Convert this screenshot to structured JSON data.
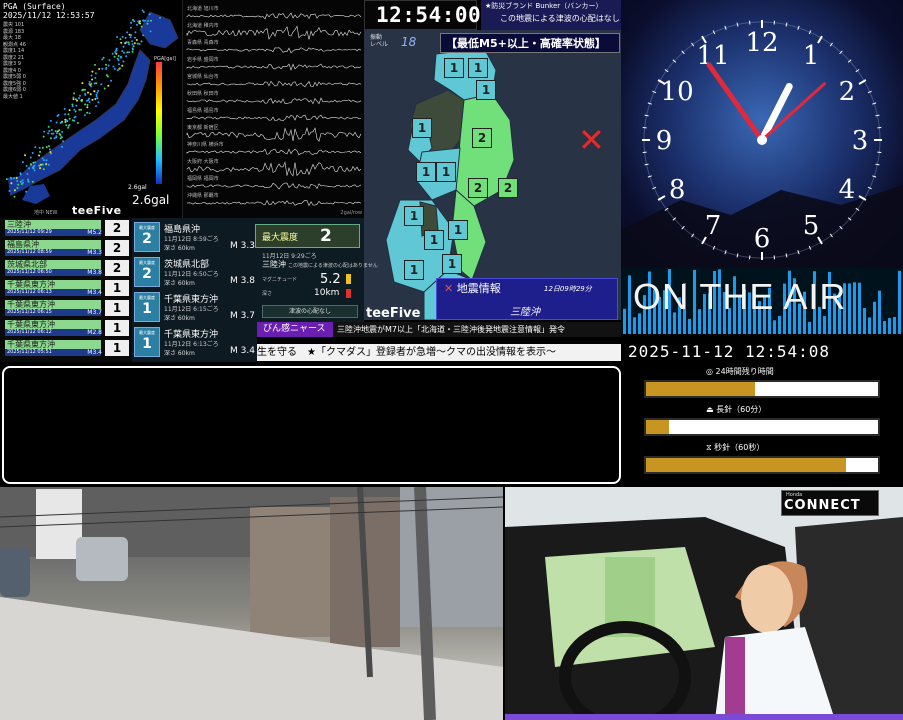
{
  "pga": {
    "title": "PGA (Surface)",
    "timestamp": "2025/11/12 12:53:57",
    "stats": [
      "震央 101",
      "震源 183",
      "最大 18",
      "観測点 46",
      "震度1 14",
      "震度2 21",
      "震度3 9",
      "震度4 0",
      "震度5弱 0",
      "震度5強 0",
      "震度6弱 0",
      "最大値 1"
    ],
    "scale_label": "PGA[gal]",
    "gal_small": "2.6gal",
    "gal_big": "2.6gal",
    "footer": "地中 NEW"
  },
  "branding": {
    "teefive": "teeFive"
  },
  "waves": {
    "labels": [
      "北海道 旭川市",
      "北海道 稚内市",
      "青森県 青森市",
      "岩手県 盛岡市",
      "宮城県 仙台市",
      "秋田県 秋田市",
      "福島県 福島市",
      "東京都 新宿区",
      "神奈川県 横浜市",
      "大阪府 大阪市",
      "福岡県 福岡市",
      "沖縄県 那覇市"
    ],
    "footer": "2gal/row"
  },
  "clock": {
    "digital": "12:54:00"
  },
  "bunker": {
    "title": "★防災ブランド Bunker（バンカー）",
    "message": "この地震による津波の心配はなし"
  },
  "tohoku": {
    "level_label": [
      "振動",
      "レベル"
    ],
    "level_value": "18",
    "warning": "【最低M5+以上・高確率状態】",
    "intensities": [
      "1",
      "1",
      "1",
      "2",
      "1",
      "1",
      "1",
      "2",
      "2",
      "1",
      "1",
      "1",
      "1",
      "1",
      "1"
    ]
  },
  "quake_info": {
    "title": "地震情報",
    "time": "12日09時29分",
    "area": "三陸沖"
  },
  "eq_list": [
    {
      "name": "三陸沖",
      "date": "2025/11/12 09:29",
      "mag": "M5.2",
      "int": "2"
    },
    {
      "name": "福島県沖",
      "date": "2025/11/12 08:59",
      "mag": "M3.3",
      "int": "2"
    },
    {
      "name": "茨城県北部",
      "date": "2025/11/12 06:50",
      "mag": "M3.8",
      "int": "2"
    },
    {
      "name": "千葉県東方沖",
      "date": "2025/11/12 06:13",
      "mag": "M3.4",
      "int": "1"
    },
    {
      "name": "千葉県東方沖",
      "date": "2025/11/12 06:15",
      "mag": "M3.7",
      "int": "1"
    },
    {
      "name": "千葉県東方沖",
      "date": "2025/11/12 06:12",
      "mag": "M2.8",
      "int": "1"
    },
    {
      "name": "千葉県東方沖",
      "date": "2025/11/12 05:51",
      "mag": "M3.4",
      "int": "1"
    }
  ],
  "cards": [
    {
      "tag": "最大震度",
      "int": "2",
      "name": "福島県沖",
      "time": "11月12日 8:59ごろ",
      "depth": "深さ 60km",
      "mag": "M 3.3"
    },
    {
      "tag": "最大震度",
      "int": "2",
      "name": "茨城県北部",
      "time": "11月12日 6:50ごろ",
      "depth": "深さ 60km",
      "mag": "M 3.8"
    },
    {
      "tag": "最大震度",
      "int": "1",
      "name": "千葉県東方沖",
      "time": "11月12日 6:15ごろ",
      "depth": "深さ 60km",
      "mag": "M 3.7"
    },
    {
      "tag": "最大震度",
      "int": "1",
      "name": "千葉県東方沖",
      "time": "11月12日 6:13ごろ",
      "depth": "深さ 60km",
      "mag": "M 3.4"
    }
  ],
  "max_panel": {
    "label": "最大震度",
    "value": "2",
    "time": "11月12日 9:29ごろ",
    "area": "三陸沖",
    "note": "この地震による津波の心配はありません",
    "mag_label": "マグニチュード",
    "mag_value": "5.2",
    "depth_label": "深さ",
    "depth_value": "10km",
    "tsunami": "津波の心配なし"
  },
  "news": {
    "label": "びん感ニャース",
    "headline": "三陸沖地震がM7以上「北海道・三陸沖後発地震注意情報」発令",
    "ticker": "生を守る　★「クマダス」登録者が急増〜クマの出没情報を表示〜"
  },
  "analog_clock": {
    "numbers": [
      "12",
      "1",
      "2",
      "3",
      "4",
      "5",
      "6",
      "7",
      "8",
      "9",
      "10",
      "11"
    ],
    "hour": 12,
    "minute": 54,
    "second": 8
  },
  "on_air": {
    "text": "ON THE AIR"
  },
  "datetime": "2025-11-12 12:54:08",
  "progress": [
    {
      "label": "◎ 24時間残り時間",
      "fraction": 0.47
    },
    {
      "label": "⏏ 長針（60分）",
      "fraction": 0.1
    },
    {
      "label": "⧖ 秒針（60秒）",
      "fraction": 0.86
    }
  ],
  "message_box": {
    "text": ""
  },
  "honda": {
    "small": "Honda",
    "big": "CONNECT"
  },
  "colors": {
    "accent_green": "#8bd88e",
    "intensity1": "#5fc8d4",
    "intensity2": "#72e07a",
    "warning_red": "#e32b2b",
    "news_purple": "#6a1fb0",
    "progress_gold": "#c89422"
  }
}
